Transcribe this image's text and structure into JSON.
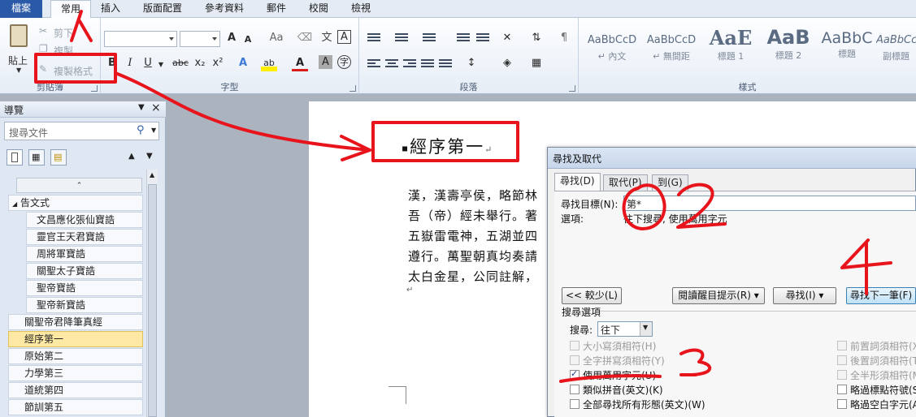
{
  "menu": {
    "tabs": [
      "檔案",
      "常用",
      "插入",
      "版面配置",
      "參考資料",
      "郵件",
      "校閱",
      "檢視"
    ]
  },
  "ribbon": {
    "clipboard": {
      "paste": "貼上",
      "cut": "剪下",
      "copy": "複製",
      "format_painter": "複製格式",
      "label": "剪貼簿"
    },
    "font": {
      "label": "字型",
      "bold": "B",
      "italic": "I",
      "underline": "U",
      "strike": "abc",
      "subscript": "x₂",
      "superscript": "x²",
      "grow": "A",
      "shrink": "A",
      "case": "Aa",
      "text_effect": "A",
      "highlight": "ab",
      "font_color": "A",
      "char_shade": "A",
      "phonetic": "文",
      "enclose": "字",
      "border": "A"
    },
    "paragraph": {
      "label": "段落"
    },
    "styles": {
      "label": "樣式",
      "items": [
        {
          "sample": "AaBbCcD",
          "name": "↵ 內文"
        },
        {
          "sample": "AaBbCcD",
          "name": "↵ 無間距"
        },
        {
          "sample": "AaE",
          "name": "標題 1"
        },
        {
          "sample": "AaB",
          "name": "標題 2"
        },
        {
          "sample": "AaBbC",
          "name": "標題"
        },
        {
          "sample": "AaBbCc",
          "name": "副標題"
        }
      ]
    }
  },
  "nav": {
    "title": "導覽",
    "search_placeholder": "搜尋文件",
    "tree": [
      {
        "label": "告文式",
        "level": 0,
        "expanded": true
      },
      {
        "label": "文昌應化張仙寶誥",
        "level": 1
      },
      {
        "label": "靈官王天君寶誥",
        "level": 1
      },
      {
        "label": "周將軍寶誥",
        "level": 1
      },
      {
        "label": "關聖太子寶誥",
        "level": 1
      },
      {
        "label": "聖帝寶誥",
        "level": 1
      },
      {
        "label": "聖帝新寶誥",
        "level": 1
      },
      {
        "label": "關聖帝君降筆真經",
        "level": 0
      },
      {
        "label": "經序第一",
        "level": 0,
        "selected": true
      },
      {
        "label": "原始第二",
        "level": 0
      },
      {
        "label": "力學第三",
        "level": 0
      },
      {
        "label": "道統第四",
        "level": 0
      },
      {
        "label": "節訓第五",
        "level": 0
      }
    ]
  },
  "document": {
    "heading": "經序第一",
    "lines": [
      "漢，漢壽亭侯，略節林",
      "吾（帝）經未舉行。著",
      "五嶽雷電神，五湖並四",
      "遵行。萬聖朝真均奏請",
      "太白金星，公同註解，"
    ]
  },
  "dialog": {
    "title": "尋找及取代",
    "tabs": [
      "尋找(D)",
      "取代(P)",
      "到(G)"
    ],
    "find_label": "尋找目標(N):",
    "find_value": "第*",
    "options_label": "選項:",
    "options_value": "往下搜尋, 使用萬用字元",
    "less_button": "<< 較少(L)",
    "reading_highlight": "閱讀醒目提示(R) ▾",
    "find_in": "尋找(I) ▾",
    "find_next": "尋找下一筆(F)",
    "search_options_label": "搜尋選項",
    "search_label": "搜尋:",
    "search_direction": "往下",
    "options_left": [
      {
        "label": "大小寫須相符(H)",
        "checked": false,
        "disabled": true
      },
      {
        "label": "全字拼寫須相符(Y)",
        "checked": false,
        "disabled": true
      },
      {
        "label": "使用萬用字元(U)",
        "checked": true,
        "disabled": false
      },
      {
        "label": "類似拼音(英文)(K)",
        "checked": false,
        "disabled": false
      },
      {
        "label": "全部尋找所有形態(英文)(W)",
        "checked": false,
        "disabled": false
      }
    ],
    "options_right": [
      {
        "label": "前置詞須相符(X)",
        "checked": false,
        "disabled": true
      },
      {
        "label": "後置詞須相符(T)",
        "checked": false,
        "disabled": true
      },
      {
        "label": "全半形須相符(M)",
        "checked": false,
        "disabled": true
      },
      {
        "label": "略過標點符號(S)",
        "checked": false,
        "disabled": false
      },
      {
        "label": "略過空白字元(A)",
        "checked": false,
        "disabled": false
      }
    ]
  },
  "annotations": {
    "color": "#e8141c",
    "step1": "1",
    "step2": "2",
    "step3": "3",
    "step4": "4"
  },
  "colors": {
    "file_tab": "#2a5aa7",
    "selected_item": "#fde9a3",
    "annotation": "#e8141c"
  }
}
